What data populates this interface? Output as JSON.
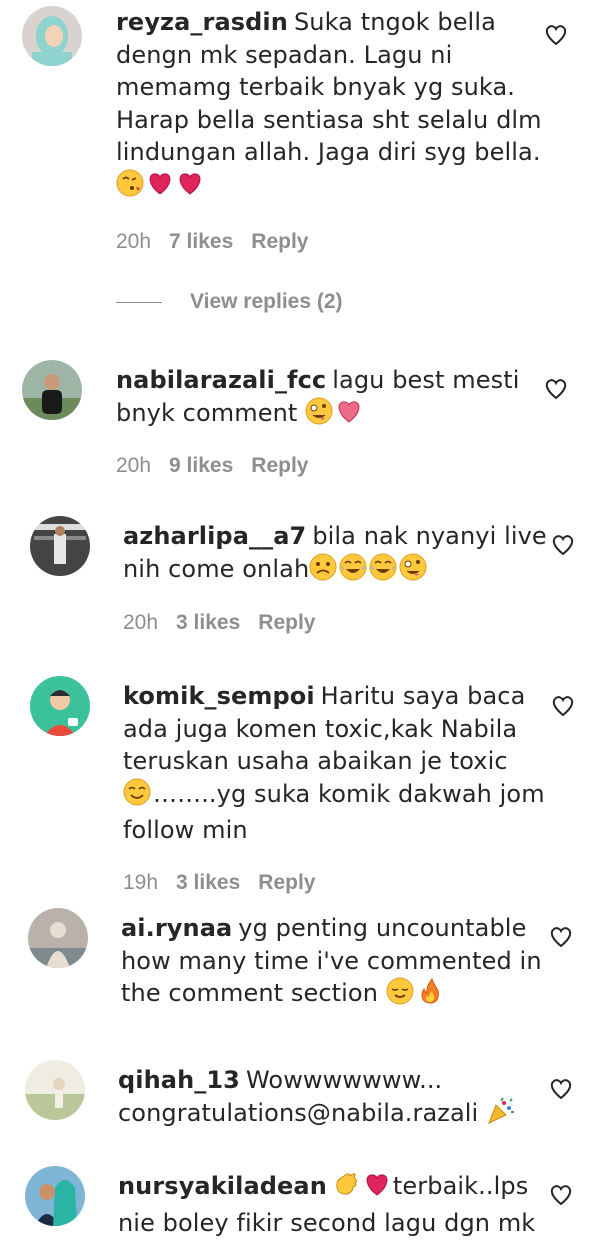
{
  "comments": [
    {
      "username": "reyza_rasdin",
      "lines": [
        "Suka tngok bella",
        "dengn mk sepadan. Lagu ni",
        "memamg terbaik bnyak yg suka.",
        "Harap bella sentiasa sht selalu dlm",
        "lindungan allah. Jaga diri syg bella."
      ],
      "emojis": [
        "kissing-face-emoji",
        "red-heart-emoji",
        "red-heart-emoji"
      ],
      "time": "20h",
      "likes": "7 likes",
      "reply": "Reply"
    },
    {
      "username": "nabilarazali_fcc",
      "lines": [
        "lagu best mesti",
        "bnyk comment"
      ],
      "emojis": [
        "zany-face-emoji",
        "heart-emoji"
      ],
      "time": "20h",
      "likes": "9 likes",
      "reply": "Reply"
    },
    {
      "username": "azharlipa__a7",
      "lines": [
        "bila nak nyanyi live",
        "nih come onlah"
      ],
      "emojis": [
        "sad-face-emoji",
        "tears-of-joy-emoji",
        "tears-of-joy-emoji",
        "zany-face-emoji"
      ],
      "time": "20h",
      "likes": "3 likes",
      "reply": "Reply"
    },
    {
      "username": "komik_sempoi",
      "lines": [
        "Haritu saya baca",
        "ada juga komen toxic,kak Nabila",
        "teruskan usaha abaikan je toxic",
        "……..yg suka komik dakwah jom",
        "follow min"
      ],
      "emojis": [
        "smiling-face-emoji"
      ],
      "time": "19h",
      "likes": "3 likes",
      "reply": "Reply"
    },
    {
      "username": "ai.rynaa",
      "lines": [
        "yg penting uncountable",
        "how many time i've commented in",
        "the comment section"
      ],
      "emojis": [
        "relieved-face-emoji",
        "fire-emoji"
      ],
      "time": "20h",
      "likes": "3 likes",
      "reply": "Reply"
    },
    {
      "username": "qihah_13",
      "lines": [
        "Wowwwwwww...",
        "congratulations@nabila.razali"
      ],
      "emojis": [
        "party-popper-emoji"
      ]
    },
    {
      "username": "nursyakiladean",
      "lines": [
        "terbaik..lps",
        "nie boley fikir second lagu dgn mk"
      ],
      "emojis": [
        "clapping-hands-emoji",
        "red-heart-emoji"
      ]
    }
  ],
  "view_replies": "View replies (2)",
  "colors": {
    "text": "#262626",
    "meta": "#8e8e8e",
    "heart_red": "#e0245e"
  }
}
